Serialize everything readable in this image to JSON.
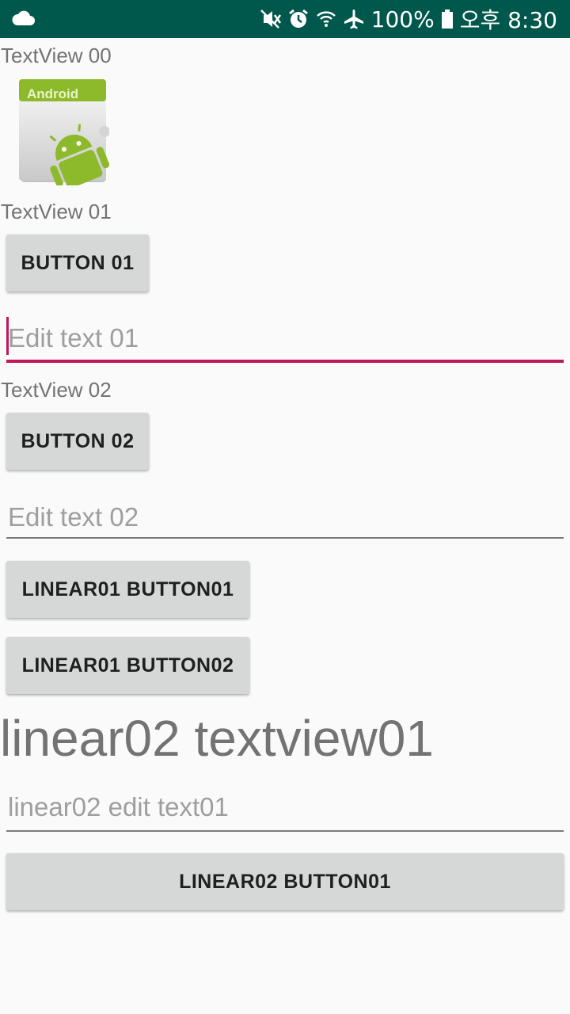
{
  "status_bar": {
    "battery": "100%",
    "time": "오후 8:30",
    "background_color": "#00574b",
    "icons": [
      "cloud-icon",
      "mute-vibrate-icon",
      "alarm-icon",
      "wifi-icon",
      "airplane-icon",
      "battery-icon"
    ]
  },
  "views": {
    "textview00": "TextView 00",
    "textview01": "TextView 01",
    "button01": "BUTTON 01",
    "edittext01": "Edit text 01",
    "textview02": "TextView 02",
    "button02": "BUTTON 02",
    "edittext02": "Edit text 02",
    "linear01_button01": "LINEAR01 BUTTON01",
    "linear01_button02": "LINEAR01 BUTTON02",
    "linear02_textview01": "linear02 textview01",
    "linear02_edittext01": "linear02 edit text01",
    "linear02_button01": "LINEAR02 BUTTON01"
  },
  "image_icon": {
    "label": "Android",
    "semantic": "android-launcher-icon"
  },
  "colors": {
    "accent": "#c2185b",
    "button_bg": "#d6d7d7",
    "hint_text": "#9e9e9e",
    "label_text": "#737373"
  }
}
